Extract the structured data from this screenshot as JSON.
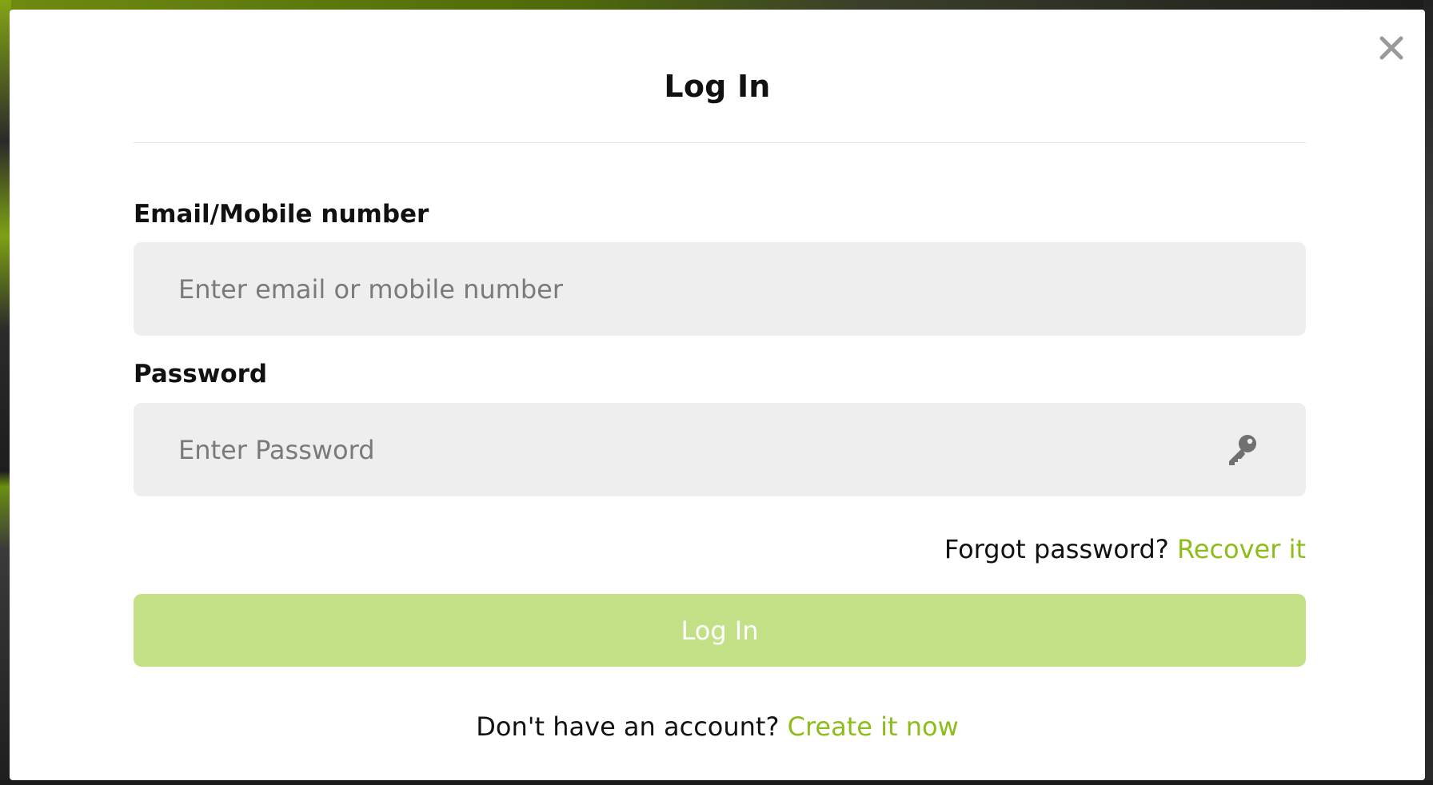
{
  "modal": {
    "title": "Log In",
    "close_icon": "close-icon"
  },
  "form": {
    "email": {
      "label": "Email/Mobile number",
      "placeholder": "Enter email or mobile number",
      "value": ""
    },
    "password": {
      "label": "Password",
      "placeholder": "Enter Password",
      "value": "",
      "toggle_icon": "key-icon"
    },
    "forgot": {
      "prompt": "Forgot password?",
      "link": "Recover it"
    },
    "submit_label": "Log In",
    "signup": {
      "prompt": "Don't have an account?",
      "link": "Create it now"
    }
  },
  "colors": {
    "accent": "#8cbd1a",
    "button_disabled": "#c3e086",
    "input_bg": "#eeeeee"
  }
}
